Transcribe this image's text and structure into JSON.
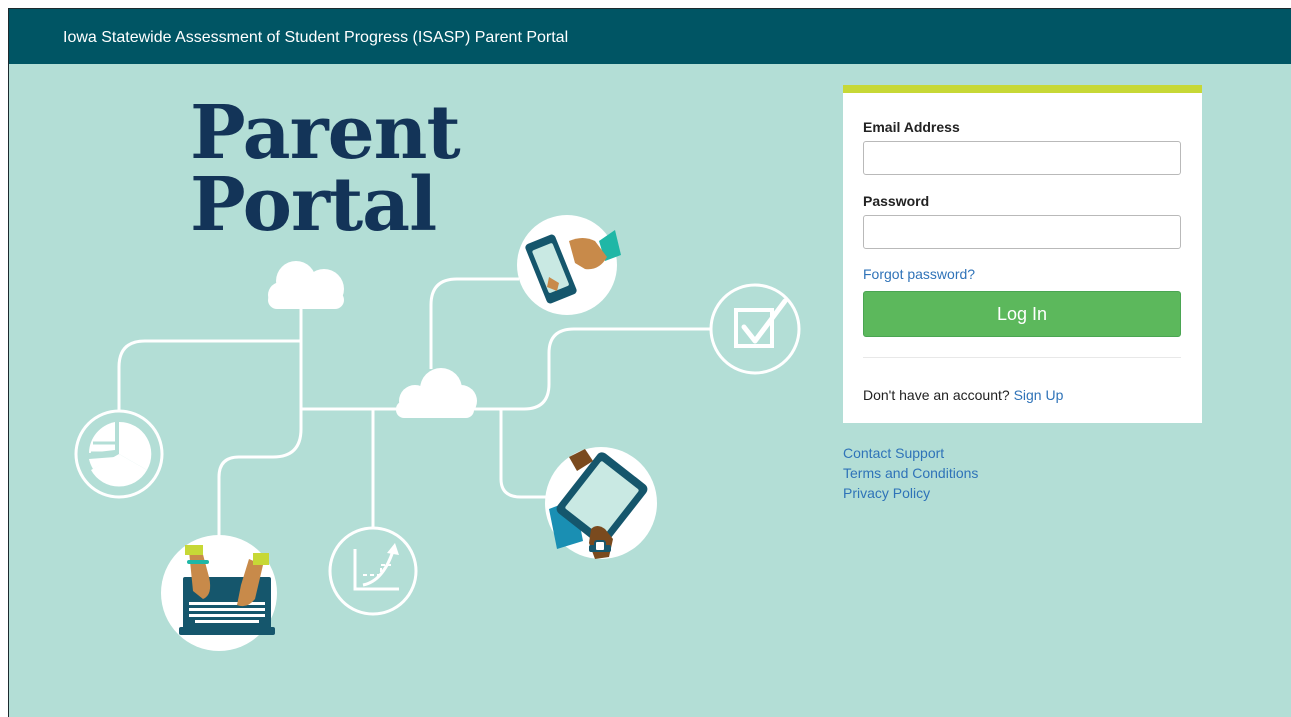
{
  "header": {
    "title": "Iowa Statewide Assessment of Student Progress (ISASP) Parent Portal"
  },
  "hero": {
    "line1": "Parent",
    "line2": "Portal"
  },
  "login": {
    "email_label": "Email Address",
    "email_value": "",
    "password_label": "Password",
    "password_value": "",
    "forgot_label": "Forgot password?",
    "login_label": "Log In",
    "no_account_text": "Don't have an account?",
    "signup_label": "Sign Up"
  },
  "footer": {
    "links": [
      "Contact Support",
      "Terms and Conditions",
      "Privacy Policy"
    ]
  },
  "illustration": {
    "icons": [
      "cloud-icon",
      "cloud-icon",
      "pie-chart-icon",
      "smartphone-hand-icon",
      "checkbox-icon",
      "laptop-hands-icon",
      "line-chart-icon",
      "tablet-hand-icon"
    ]
  },
  "colors": {
    "header_bg": "#005564",
    "page_bg": "#b3ded6",
    "hero_text": "#133458",
    "card_accent": "#c7d836",
    "login_button": "#5cb85c",
    "link": "#2f73b8"
  }
}
